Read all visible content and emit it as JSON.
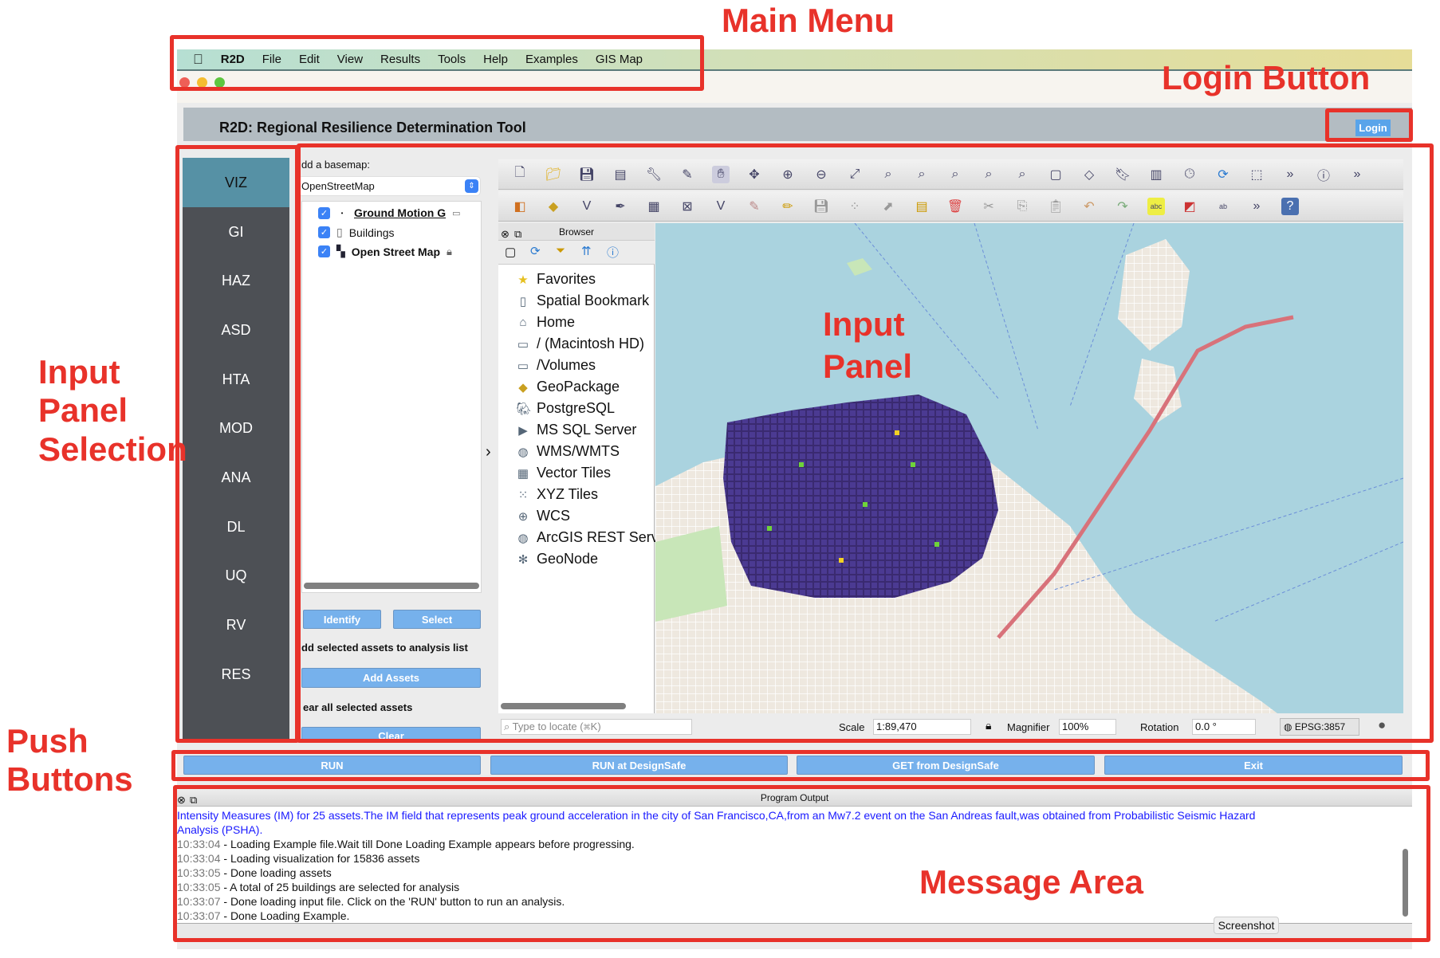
{
  "menu": {
    "app": "R2D",
    "items": [
      "File",
      "Edit",
      "View",
      "Results",
      "Tools",
      "Help",
      "Examples",
      "GIS Map"
    ]
  },
  "window": {
    "title": "R2D: Regional Resilience Determination Tool",
    "login_label": "Login"
  },
  "sidebar": {
    "selected": "VIZ",
    "items": [
      "VIZ",
      "GI",
      "HAZ",
      "ASD",
      "HTA",
      "MOD",
      "ANA",
      "DL",
      "UQ",
      "RV",
      "RES"
    ]
  },
  "left_panel": {
    "basemap_label": "dd a basemap:",
    "basemap_value": "OpenStreetMap",
    "layers": [
      {
        "name": "Ground Motion G",
        "checked": true
      },
      {
        "name": "Buildings",
        "checked": true
      },
      {
        "name": "Open Street Map",
        "checked": true
      }
    ],
    "identify_label": "Identify",
    "select_label": "Select",
    "add_label": "dd selected assets to analysis list",
    "add_button": "Add Assets",
    "clear_label": "ear all selected assets",
    "clear_button": "Clear"
  },
  "browser": {
    "title": "Browser",
    "items": [
      "Favorites",
      "Spatial Bookmark",
      "Home",
      "/ (Macintosh HD)",
      "/Volumes",
      "GeoPackage",
      "PostgreSQL",
      "MS SQL Server",
      "WMS/WMTS",
      "Vector Tiles",
      "XYZ Tiles",
      "WCS",
      "ArcGIS REST Serv",
      "GeoNode"
    ]
  },
  "status": {
    "search_placeholder": "Type to locate (⌘K)",
    "scale_label": "Scale",
    "scale_value": "1:89,470",
    "magnifier_label": "Magnifier",
    "magnifier_value": "100%",
    "rotation_label": "Rotation",
    "rotation_value": "0.0 °",
    "crs": "EPSG:3857"
  },
  "push_buttons": [
    "RUN",
    "RUN at DesignSafe",
    "GET from DesignSafe",
    "Exit"
  ],
  "output": {
    "title": "Program Output",
    "intro": [
      "Intensity Measures (IM) for 25 assets.The IM field that represents peak ground acceleration in the city of San Francisco,CA,from an Mw7.2 event on the San Andreas fault,was obtained from Probabilistic Seismic Hazard",
      "Analysis (PSHA)."
    ],
    "lines": [
      {
        "time": "10:33:04",
        "text": " - Loading Example file.Wait till Done Loading Example appears before progressing."
      },
      {
        "time": "10:33:04",
        "text": " - Loading visualization for 15836 assets"
      },
      {
        "time": "10:33:05",
        "text": " - Done loading assets"
      },
      {
        "time": "10:33:05",
        "text": " - A total of 25 buildings are selected for analysis"
      },
      {
        "time": "10:33:07",
        "text": " - Done loading input file. Click on the 'RUN' button to run an analysis."
      },
      {
        "time": "10:33:07",
        "text": " - Done Loading Example."
      }
    ],
    "tooltip": "Screenshot"
  },
  "annotations": {
    "main_menu": "Main Menu",
    "login": "Login Button",
    "panel_selection": "Input\nPanel\nSelection",
    "input_panel": "Input\nPanel",
    "push_buttons": "Push\nButtons",
    "message_area": "Message Area"
  },
  "colors": {
    "annotation": "#e8322a",
    "button": "#76b1ec",
    "sidebar": "#4d5055",
    "sidebar_selected": "#5691a5",
    "intro_text": "#1a1aff"
  }
}
